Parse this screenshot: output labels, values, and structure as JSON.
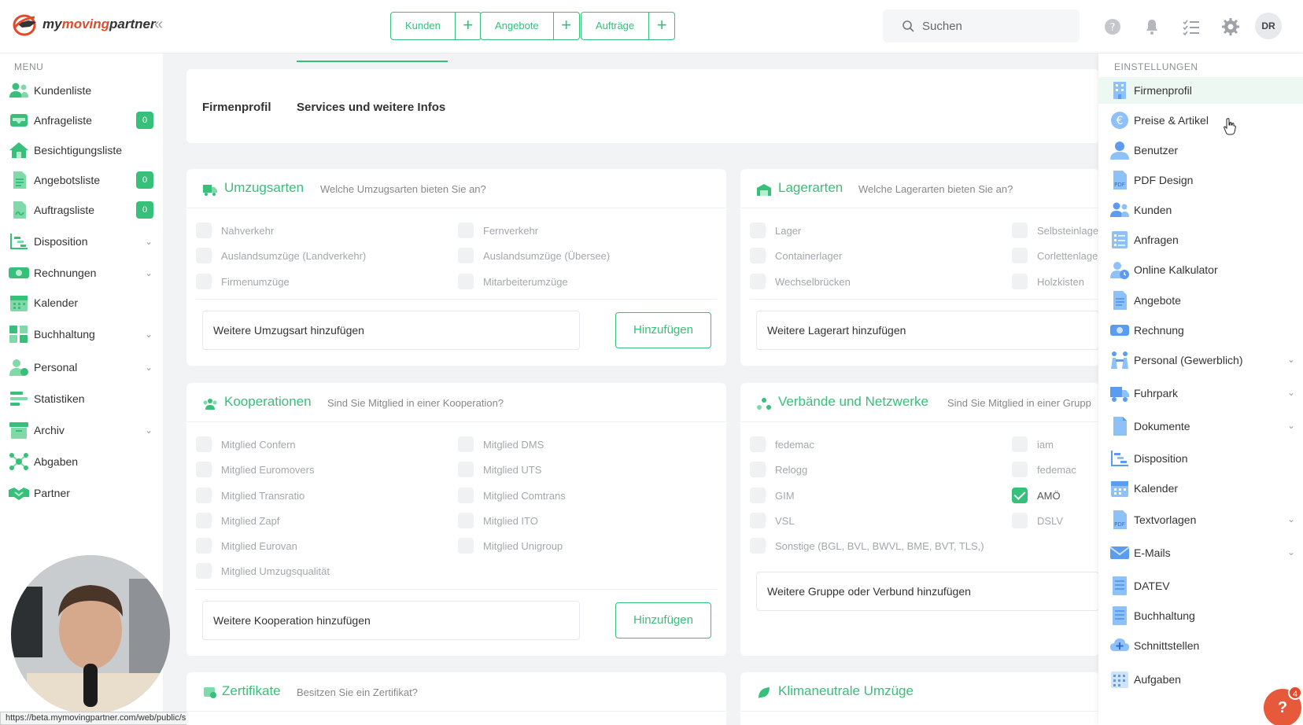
{
  "brand": {
    "logo_part1": "my",
    "logo_part2": "moving",
    "logo_part3": "partner"
  },
  "topbar": {
    "quick_actions": [
      {
        "label": "Kunden"
      },
      {
        "label": "Angebote"
      },
      {
        "label": "Aufträge"
      }
    ],
    "plus_glyph": "+",
    "search_placeholder": "Suchen",
    "avatar_initials": "DR"
  },
  "sidebar": {
    "heading": "MENU",
    "items": [
      {
        "label": "Kundenliste",
        "icon": "users-icon"
      },
      {
        "label": "Anfrageliste",
        "icon": "inbox-icon",
        "badge": "0"
      },
      {
        "label": "Besichtigungsliste",
        "icon": "home-icon"
      },
      {
        "label": "Angebotsliste",
        "icon": "document-icon",
        "badge": "0"
      },
      {
        "label": "Auftragsliste",
        "icon": "contract-icon",
        "badge": "0"
      },
      {
        "label": "Disposition",
        "icon": "gantt-icon",
        "chevron": true
      },
      {
        "label": "Rechnungen",
        "icon": "money-icon",
        "chevron": true
      },
      {
        "label": "Kalender",
        "icon": "calendar-icon"
      },
      {
        "label": "Buchhaltung",
        "icon": "accounting-icon",
        "chevron": true
      },
      {
        "label": "Personal",
        "icon": "personnel-icon",
        "chevron": true
      },
      {
        "label": "Statistiken",
        "icon": "stats-icon"
      },
      {
        "label": "Archiv",
        "icon": "archive-icon",
        "chevron": true
      },
      {
        "label": "Abgaben",
        "icon": "network-icon"
      },
      {
        "label": "Partner",
        "icon": "handshake-icon"
      }
    ]
  },
  "tabs": [
    {
      "label": "Firmenprofil"
    },
    {
      "label": "Services und weitere Infos"
    }
  ],
  "cards": {
    "umzugsarten": {
      "title": "Umzugsarten",
      "subtitle": "Welche Umzugsarten bieten Sie an?",
      "options": [
        "Nahverkehr",
        "Fernverkehr",
        "Auslandsumzüge (Landverkehr)",
        "Auslandsumzüge (Übersee)",
        "Firmenumzüge",
        "Mitarbeiterumzüge"
      ],
      "input_value": "Weitere Umzugsart hinzufügen",
      "button": "Hinzufügen"
    },
    "lagerarten": {
      "title": "Lagerarten",
      "subtitle": "Welche Lagerarten bieten Sie an?",
      "options": [
        "Lager",
        "Selbsteinlage",
        "Containerlager",
        "Corlettenlage",
        "Wechselbrücken",
        "Holzkisten"
      ],
      "input_value": "Weitere Lagerart hinzufügen"
    },
    "kooperationen": {
      "title": "Kooperationen",
      "subtitle": "Sind Sie Mitglied in einer Kooperation?",
      "options": [
        "Mitglied Confern",
        "Mitglied DMS",
        "Mitglied Euromovers",
        "Mitglied UTS",
        "Mitglied Transratio",
        "Mitglied Comtrans",
        "Mitglied Zapf",
        "Mitglied ITO",
        "Mitglied Eurovan",
        "Mitglied Unigroup",
        "Mitglied Umzugsqualität"
      ],
      "input_value": "Weitere Kooperation hinzufügen",
      "button": "Hinzufügen"
    },
    "verbaende": {
      "title": "Verbände und Netzwerke",
      "subtitle": "Sind Sie Mitglied in einer Grupp",
      "options": [
        "fedemac",
        "iam",
        "Relogg",
        "fedemac",
        "GIM",
        "AMÖ",
        "VSL",
        "DSLV",
        "Sonstige (BGL, BVL, BWVL, BME, BVT, TLS,)"
      ],
      "checked": [
        "AMÖ"
      ],
      "input_value": "Weitere Gruppe oder Verbund hinzufügen"
    },
    "zertifikate": {
      "title": "Zertifikate",
      "subtitle": "Besitzen Sie ein Zertifikat?"
    },
    "klima": {
      "title": "Klimaneutrale Umzüge"
    }
  },
  "settings": {
    "heading": "EINSTELLUNGEN",
    "items": [
      {
        "label": "Firmenprofil",
        "icon": "building-icon",
        "active": true
      },
      {
        "label": "Preise & Artikel",
        "icon": "euro-icon"
      },
      {
        "label": "Benutzer",
        "icon": "user-icon"
      },
      {
        "label": "PDF Design",
        "icon": "pdf-icon"
      },
      {
        "label": "Kunden",
        "icon": "users-icon"
      },
      {
        "label": "Anfragen",
        "icon": "list-icon"
      },
      {
        "label": "Online Kalkulator",
        "icon": "user-clock-icon"
      },
      {
        "label": "Angebote",
        "icon": "document-icon"
      },
      {
        "label": "Rechnung",
        "icon": "money-icon"
      },
      {
        "label": "Personal (Gewerblich)",
        "icon": "workers-icon",
        "chevron": true
      },
      {
        "label": "Fuhrpark",
        "icon": "truck-icon",
        "chevron": true
      },
      {
        "label": "Dokumente",
        "icon": "file-icon",
        "chevron": true
      },
      {
        "label": "Disposition",
        "icon": "gantt-icon"
      },
      {
        "label": "Kalender",
        "icon": "calendar-icon"
      },
      {
        "label": "Textvorlagen",
        "icon": "pdf-icon",
        "chevron": true
      },
      {
        "label": "E-Mails",
        "icon": "mail-icon",
        "chevron": true
      },
      {
        "label": "DATEV",
        "icon": "doc-lines-icon"
      },
      {
        "label": "Buchhaltung",
        "icon": "doc-lines-icon"
      },
      {
        "label": "Schnittstellen",
        "icon": "cloud-plus-icon"
      },
      {
        "label": "Aufgaben",
        "icon": "calendar-grid-icon"
      }
    ]
  },
  "help": {
    "glyph": "?",
    "badge": "4"
  },
  "status_url": "https://beta.mymovingpartner.com/web/public/sp-pricing/settings",
  "colors": {
    "accent": "#36c079",
    "brand": "#e24a2b",
    "icon_blue": "#5b9bf0"
  }
}
